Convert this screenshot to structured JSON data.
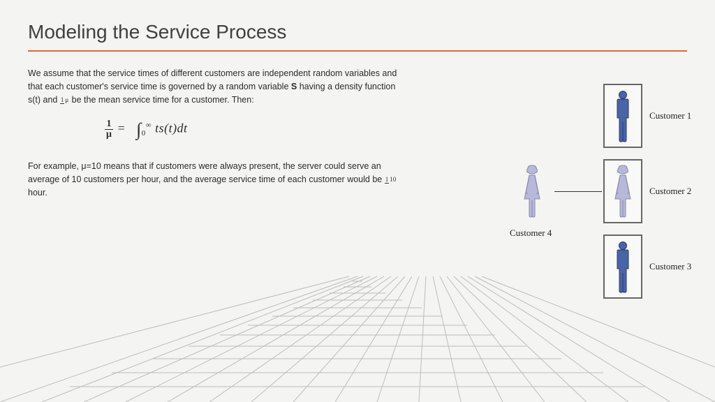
{
  "title": "Modeling the Service Process",
  "para1_a": "We assume that the service times of different customers are independent random variables and that each customer's service time is governed by a random variable ",
  "para1_bold": "S",
  "para1_b": " having a density function s(t) and ",
  "para1_c": " be the mean service time for a customer. Then:",
  "eq_frac_num": "1",
  "eq_frac_den": "μ",
  "eq_body": "ts(t)dt",
  "eq_int_upper": "∞",
  "eq_int_lower": "0",
  "para2_a": "For example, μ=10  means that if customers were always present, the server could serve an average of 10 customers per hour, and the average service time of each customer would be ",
  "para2_frac_num": "1",
  "para2_frac_den": "10",
  "para2_b": " hour.",
  "customers": {
    "c1": "Customer 1",
    "c2": "Customer 2",
    "c3": "Customer 3",
    "c4": "Customer 4"
  },
  "inline_frac_num": "1",
  "inline_frac_den": "μ"
}
